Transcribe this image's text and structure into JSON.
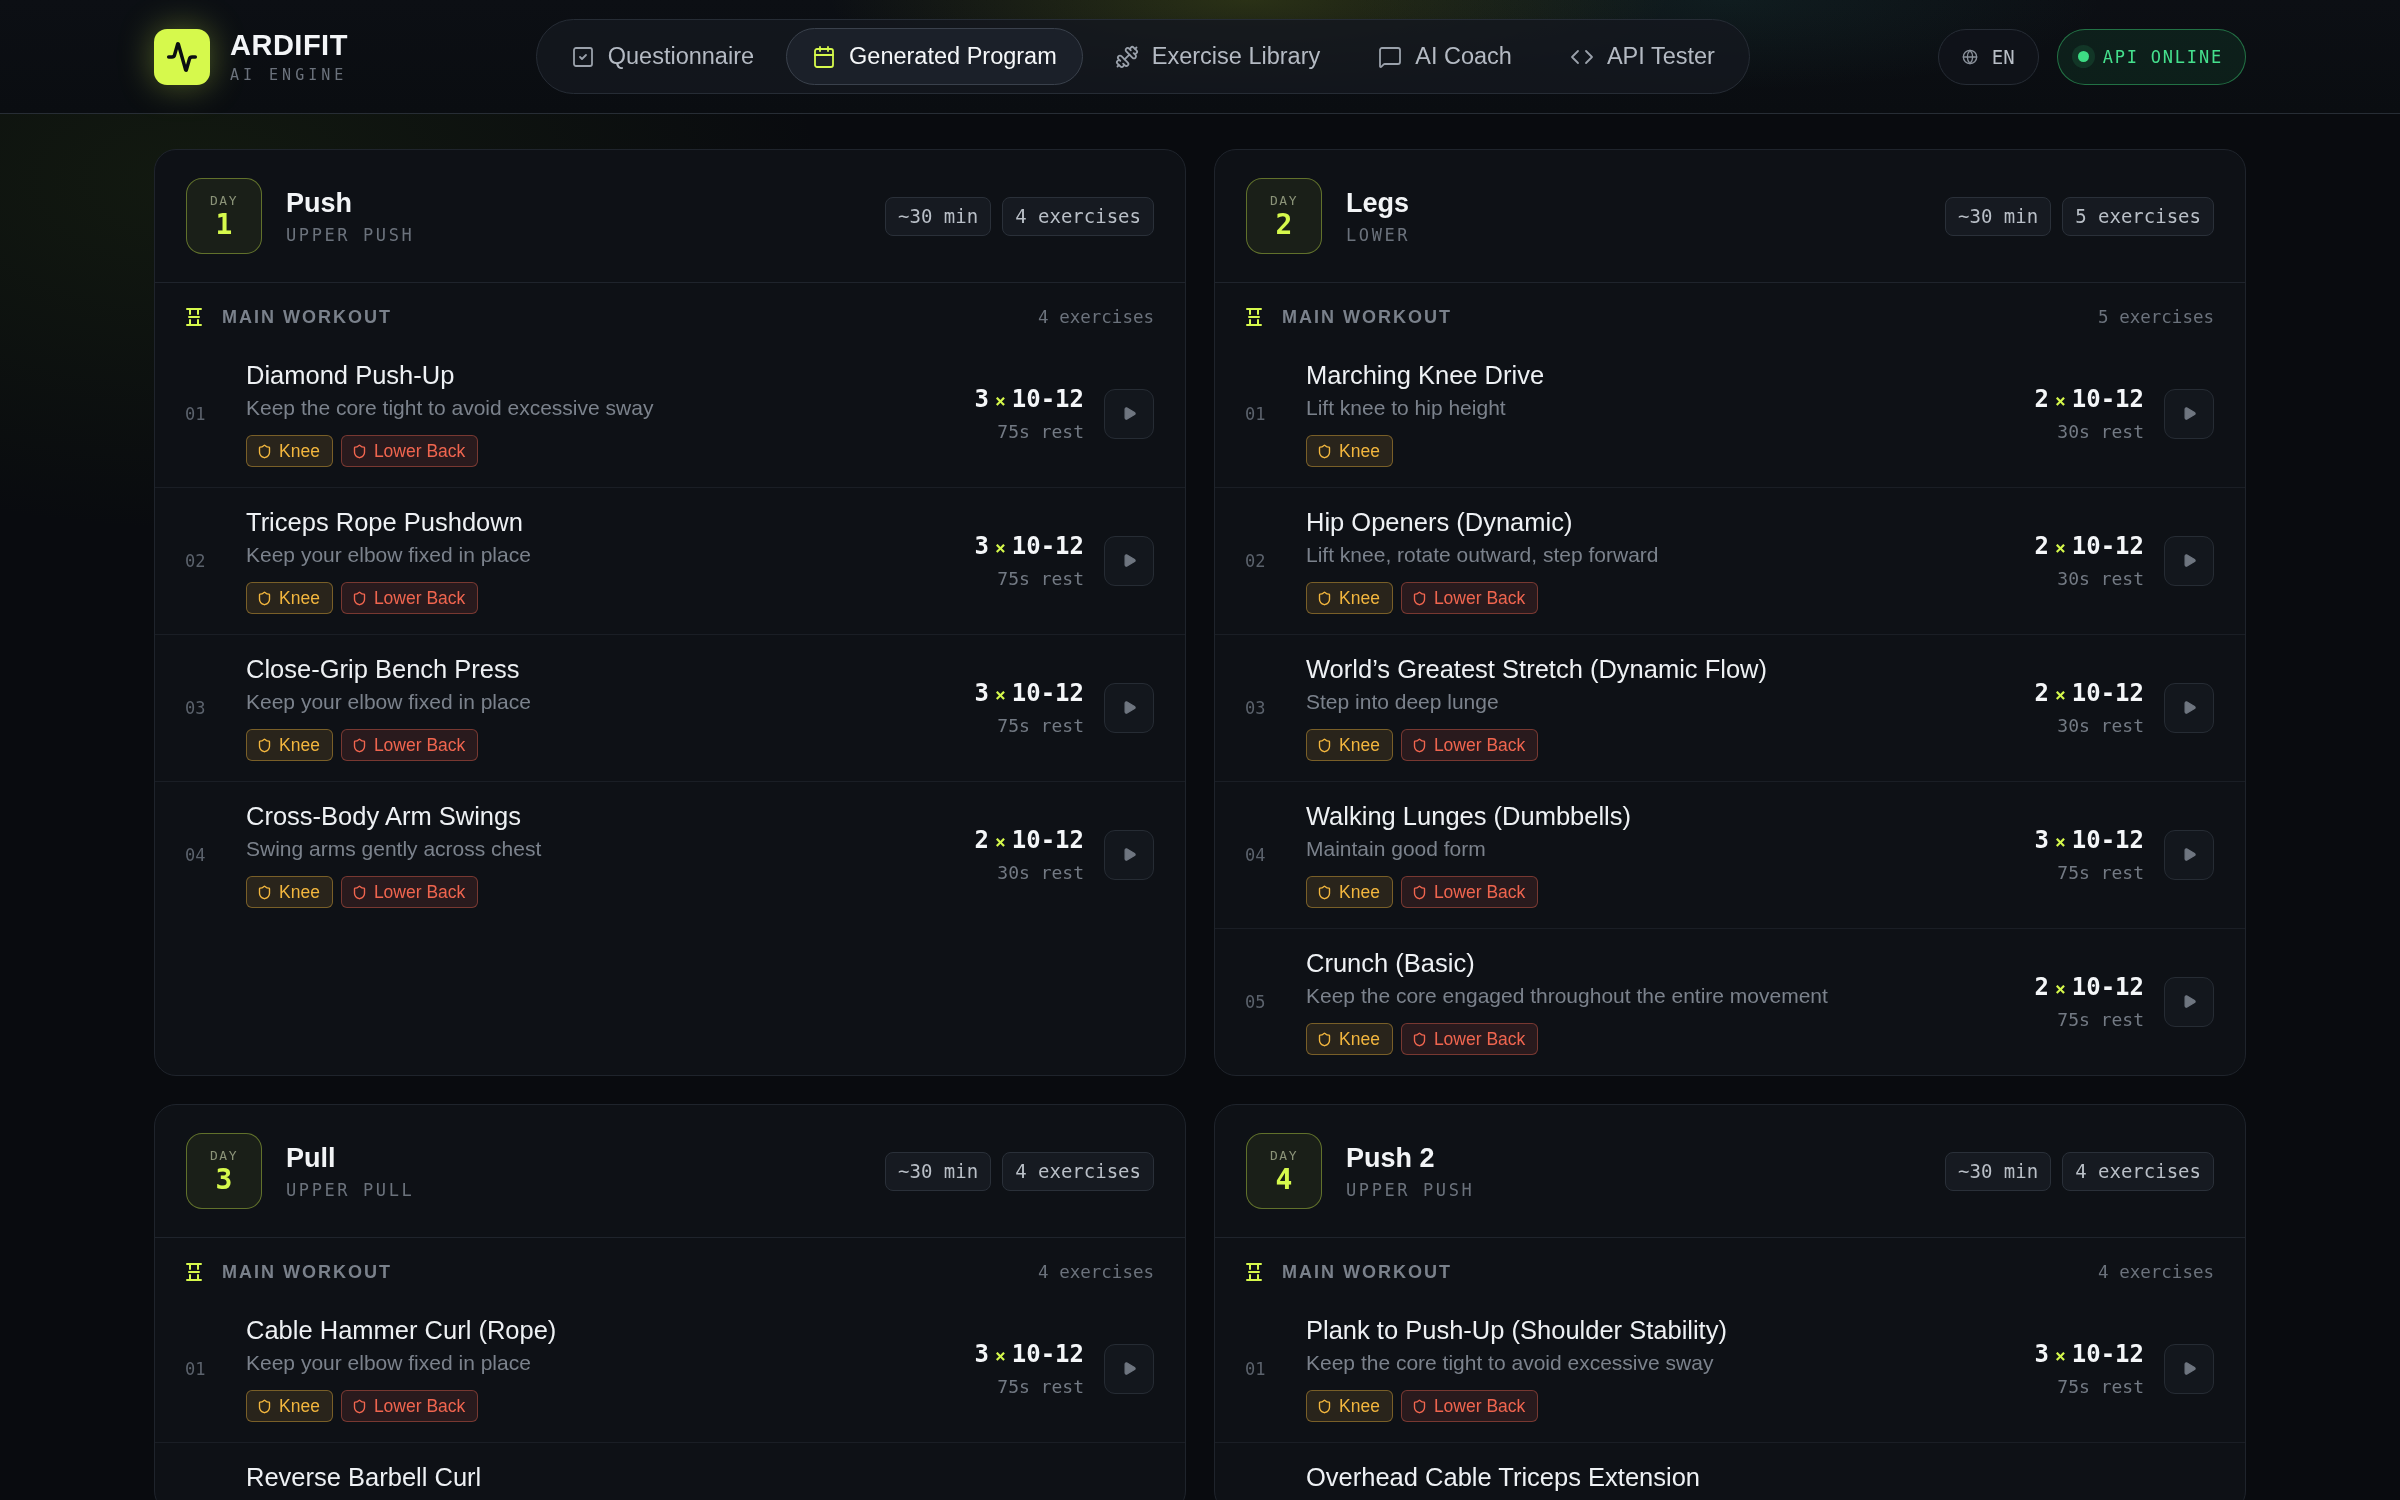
{
  "header": {
    "brand": {
      "name": "ARDIFIT",
      "tagline": "AI ENGINE"
    },
    "nav": [
      {
        "label": "Questionnaire",
        "selected": false
      },
      {
        "label": "Generated Program",
        "selected": true
      },
      {
        "label": "Exercise Library",
        "selected": false
      },
      {
        "label": "AI Coach",
        "selected": false
      },
      {
        "label": "API Tester",
        "selected": false
      }
    ],
    "language": "EN",
    "status": {
      "label": "API ONLINE",
      "online": true
    }
  },
  "days": [
    {
      "day_label": "DAY",
      "day": "1",
      "title": "Push",
      "subtitle": "UPPER PUSH",
      "duration": "~30 min",
      "count": "4 exercises",
      "section": {
        "title": "MAIN WORKOUT",
        "count": "4 exercises",
        "exercises": [
          {
            "number": "01",
            "name": "Diamond Push-Up",
            "description": "Keep the core tight to avoid excessive sway",
            "tags": [
              {
                "label": "Knee",
                "color": "#f2b63e"
              },
              {
                "label": "Lower Back",
                "color": "#f0654f"
              }
            ],
            "sets": "3",
            "sign": "×",
            "reps": "10-12",
            "rest": "75s rest"
          },
          {
            "number": "02",
            "name": "Triceps Rope Pushdown",
            "description": "Keep your elbow fixed in place",
            "tags": [
              {
                "label": "Knee",
                "color": "#f2b63e"
              },
              {
                "label": "Lower Back",
                "color": "#f0654f"
              }
            ],
            "sets": "3",
            "sign": "×",
            "reps": "10-12",
            "rest": "75s rest"
          },
          {
            "number": "03",
            "name": "Close-Grip Bench Press",
            "description": "Keep your elbow fixed in place",
            "tags": [
              {
                "label": "Knee",
                "color": "#f2b63e"
              },
              {
                "label": "Lower Back",
                "color": "#f0654f"
              }
            ],
            "sets": "3",
            "sign": "×",
            "reps": "10-12",
            "rest": "75s rest"
          },
          {
            "number": "04",
            "name": "Cross-Body Arm Swings",
            "description": "Swing arms gently across chest",
            "tags": [
              {
                "label": "Knee",
                "color": "#f2b63e"
              },
              {
                "label": "Lower Back",
                "color": "#f0654f"
              }
            ],
            "sets": "2",
            "sign": "×",
            "reps": "10-12",
            "rest": "30s rest"
          }
        ]
      }
    },
    {
      "day_label": "DAY",
      "day": "2",
      "title": "Legs",
      "subtitle": "LOWER",
      "duration": "~30 min",
      "count": "5 exercises",
      "section": {
        "title": "MAIN WORKOUT",
        "count": "5 exercises",
        "exercises": [
          {
            "number": "01",
            "name": "Marching Knee Drive",
            "description": "Lift knee to hip height",
            "tags": [
              {
                "label": "Knee",
                "color": "#f2b63e"
              }
            ],
            "sets": "2",
            "sign": "×",
            "reps": "10-12",
            "rest": "30s rest"
          },
          {
            "number": "02",
            "name": "Hip Openers (Dynamic)",
            "description": "Lift knee, rotate outward, step forward",
            "tags": [
              {
                "label": "Knee",
                "color": "#f2b63e"
              },
              {
                "label": "Lower Back",
                "color": "#f0654f"
              }
            ],
            "sets": "2",
            "sign": "×",
            "reps": "10-12",
            "rest": "30s rest"
          },
          {
            "number": "03",
            "name": "World’s Greatest Stretch (Dynamic Flow)",
            "description": "Step into deep lunge",
            "tags": [
              {
                "label": "Knee",
                "color": "#f2b63e"
              },
              {
                "label": "Lower Back",
                "color": "#f0654f"
              }
            ],
            "sets": "2",
            "sign": "×",
            "reps": "10-12",
            "rest": "30s rest"
          },
          {
            "number": "04",
            "name": "Walking Lunges (Dumbbells)",
            "description": "Maintain good form",
            "tags": [
              {
                "label": "Knee",
                "color": "#f2b63e"
              },
              {
                "label": "Lower Back",
                "color": "#f0654f"
              }
            ],
            "sets": "3",
            "sign": "×",
            "reps": "10-12",
            "rest": "75s rest"
          },
          {
            "number": "05",
            "name": "Crunch (Basic)",
            "description": "Keep the core engaged throughout the entire movement",
            "tags": [
              {
                "label": "Knee",
                "color": "#f2b63e"
              },
              {
                "label": "Lower Back",
                "color": "#f0654f"
              }
            ],
            "sets": "2",
            "sign": "×",
            "reps": "10-12",
            "rest": "75s rest"
          }
        ]
      }
    },
    {
      "day_label": "DAY",
      "day": "3",
      "title": "Pull",
      "subtitle": "UPPER PULL",
      "duration": "~30 min",
      "count": "4 exercises",
      "section": {
        "title": "MAIN WORKOUT",
        "count": "4 exercises",
        "exercises": [
          {
            "number": "01",
            "name": "Cable Hammer Curl (Rope)",
            "description": "Keep your elbow fixed in place",
            "tags": [
              {
                "label": "Knee",
                "color": "#f2b63e"
              },
              {
                "label": "Lower Back",
                "color": "#f0654f"
              }
            ],
            "sets": "3",
            "sign": "×",
            "reps": "10-12",
            "rest": "75s rest"
          },
          {
            "name": "Reverse Barbell Curl"
          }
        ]
      }
    },
    {
      "day_label": "DAY",
      "day": "4",
      "title": "Push 2",
      "subtitle": "UPPER PUSH",
      "duration": "~30 min",
      "count": "4 exercises",
      "section": {
        "title": "MAIN WORKOUT",
        "count": "4 exercises",
        "exercises": [
          {
            "number": "01",
            "name": "Plank to Push-Up (Shoulder Stability)",
            "description": "Keep the core tight to avoid excessive sway",
            "tags": [
              {
                "label": "Knee",
                "color": "#f2b63e"
              },
              {
                "label": "Lower Back",
                "color": "#f0654f"
              }
            ],
            "sets": "3",
            "sign": "×",
            "reps": "10-12",
            "rest": "75s rest"
          },
          {
            "name": "Overhead Cable Triceps Extension"
          }
        ]
      }
    }
  ]
}
